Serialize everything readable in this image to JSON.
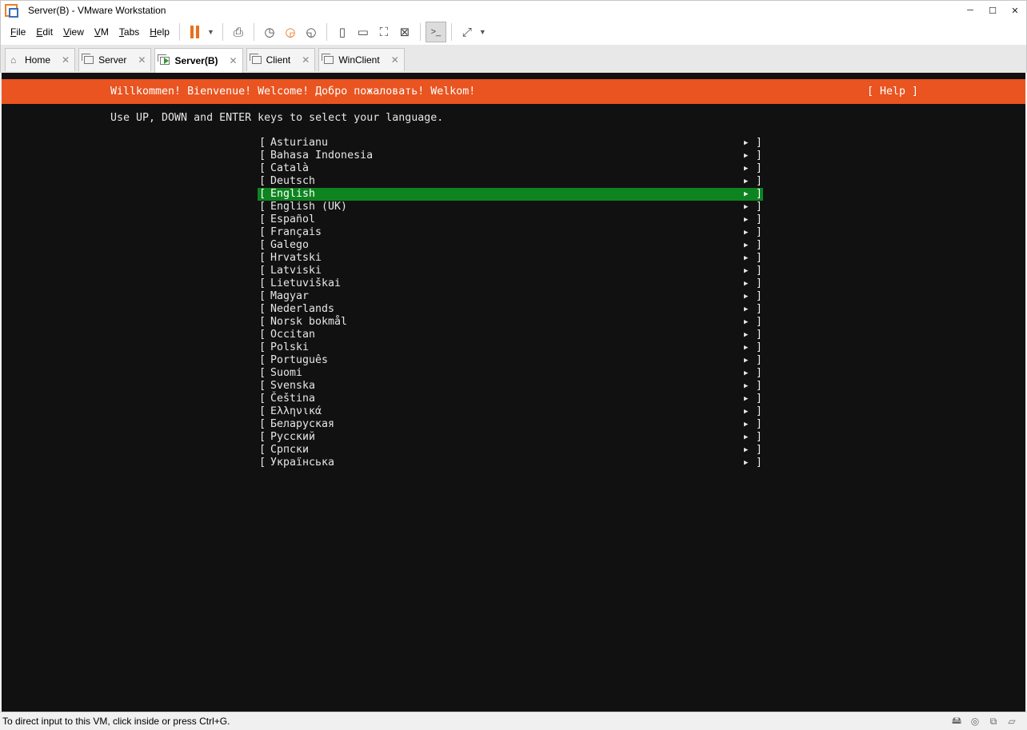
{
  "window": {
    "title": "Server(B) - VMware Workstation",
    "controls": [
      "─",
      "☐",
      "✕"
    ]
  },
  "menu": [
    {
      "label": "File",
      "key": "F",
      "rest": "ile"
    },
    {
      "label": "Edit",
      "key": "E",
      "rest": "dit"
    },
    {
      "label": "View",
      "key": "V",
      "rest": "iew"
    },
    {
      "label": "VM",
      "key": "V",
      "rest": "M"
    },
    {
      "label": "Tabs",
      "key": "T",
      "rest": "abs"
    },
    {
      "label": "Help",
      "key": "H",
      "rest": "elp"
    }
  ],
  "tabs": [
    {
      "label": "Home",
      "icon": "home-icon",
      "active": false
    },
    {
      "label": "Server",
      "icon": "vm-icon",
      "active": false
    },
    {
      "label": "Server(B)",
      "icon": "vm-running-icon",
      "active": true
    },
    {
      "label": "Client",
      "icon": "vm-icon",
      "active": false
    },
    {
      "label": "WinClient",
      "icon": "vm-icon",
      "active": false
    }
  ],
  "installer": {
    "banner_text": "Willkommen! Bienvenue! Welcome! Добро пожаловать! Welkom!",
    "help_label": "[ Help ]",
    "instruction": "Use UP, DOWN and ENTER keys to select your language.",
    "selected_index": 4,
    "languages": [
      "Asturianu",
      "Bahasa Indonesia",
      "Català",
      "Deutsch",
      "English",
      "English (UK)",
      "Español",
      "Français",
      "Galego",
      "Hrvatski",
      "Latviski",
      "Lietuviškai",
      "Magyar",
      "Nederlands",
      "Norsk bokmål",
      "Occitan",
      "Polski",
      "Português",
      "Suomi",
      "Svenska",
      "Čeština",
      "Ελληνικά",
      "Беларуская",
      "Русский",
      "Српски",
      "Українська"
    ],
    "bracket_left": "[",
    "bracket_right": "]",
    "arrow": "▶"
  },
  "colors": {
    "banner": "#e95420",
    "selection": "#0e8420",
    "console_bg": "#111111"
  },
  "status": {
    "text": "To direct input to this VM, click inside or press Ctrl+G."
  }
}
